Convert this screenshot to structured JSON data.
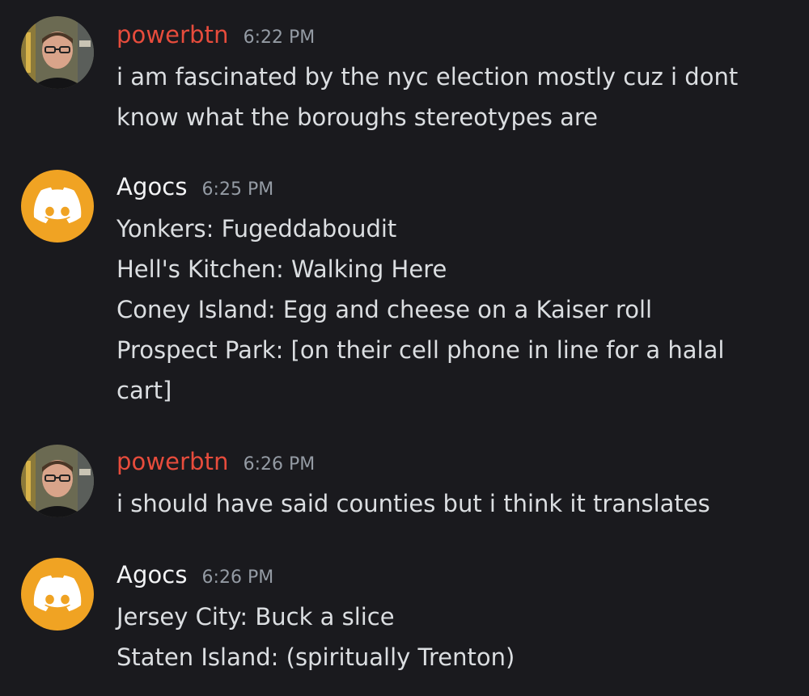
{
  "colors": {
    "background": "#1a1a1e",
    "text": "#dbdee1",
    "timestamp": "#949ba4",
    "powerbtn_name": "#e74c3c",
    "agocs_name": "#f2f3f5",
    "discord_avatar_bg": "#f0a323"
  },
  "messages": [
    {
      "author": "powerbtn",
      "avatar_icon": "user-photo-avatar",
      "timestamp": "6:22 PM",
      "lines": [
        "i am fascinated by the nyc election mostly cuz i dont",
        "know what the boroughs stereotypes are"
      ]
    },
    {
      "author": "Agocs",
      "avatar_icon": "discord-logo-icon",
      "timestamp": "6:25 PM",
      "lines": [
        "Yonkers: Fugeddaboudit",
        "Hell's Kitchen: Walking Here",
        "Coney Island: Egg and cheese on a Kaiser roll",
        "Prospect Park: [on their cell phone in line for a halal",
        "cart]"
      ]
    },
    {
      "author": "powerbtn",
      "avatar_icon": "user-photo-avatar",
      "timestamp": "6:26 PM",
      "lines": [
        "i should have said counties but i think it translates"
      ]
    },
    {
      "author": "Agocs",
      "avatar_icon": "discord-logo-icon",
      "timestamp": "6:26 PM",
      "lines": [
        "Jersey City: Buck a slice",
        "Staten Island: (spiritually Trenton)"
      ]
    }
  ]
}
